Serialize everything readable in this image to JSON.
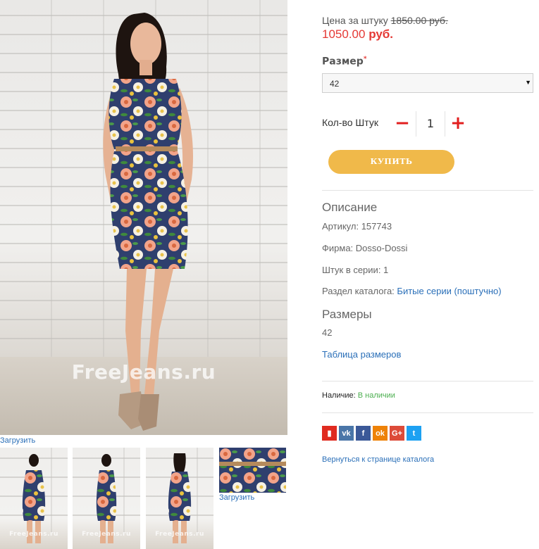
{
  "gallery": {
    "watermark": "FreeJeans.ru",
    "load_label_main": "Загрузить",
    "load_label_thumb": "Загрузить"
  },
  "price": {
    "label": "Цена за штуку",
    "old": "1850.00 руб.",
    "new_amount": "1050.00",
    "new_currency": "руб."
  },
  "size": {
    "label": "Размер",
    "required_mark": "*",
    "selected": "42"
  },
  "quantity": {
    "label": "Кол-во Штук",
    "value": "1",
    "minus": "−",
    "plus": "+"
  },
  "buy_button": "КУПИТЬ",
  "description": {
    "title": "Описание",
    "article": "Артикул: 157743",
    "brand": "Фирма: Dosso-Dossi",
    "pieces": "Штук в серии: 1",
    "catalog_label": "Раздел каталога:",
    "catalog_link": "Битые серии (поштучно)"
  },
  "sizes": {
    "title": "Размеры",
    "value": "42",
    "table_link": "Таблица размеров"
  },
  "availability": {
    "label": "Наличие:",
    "value": "В наличии"
  },
  "share": [
    {
      "name": "bookmark-icon",
      "glyph": "▮",
      "color": "#e02b20"
    },
    {
      "name": "vk-icon",
      "glyph": "vk",
      "color": "#4a76a8"
    },
    {
      "name": "facebook-icon",
      "glyph": "f",
      "color": "#3b5998"
    },
    {
      "name": "odnoklassniki-icon",
      "glyph": "ok",
      "color": "#ee8208"
    },
    {
      "name": "google-plus-icon",
      "glyph": "G+",
      "color": "#dd4b39"
    },
    {
      "name": "twitter-icon",
      "glyph": "t",
      "color": "#1da1f2"
    }
  ],
  "back_link": "Вернуться к странице каталога"
}
